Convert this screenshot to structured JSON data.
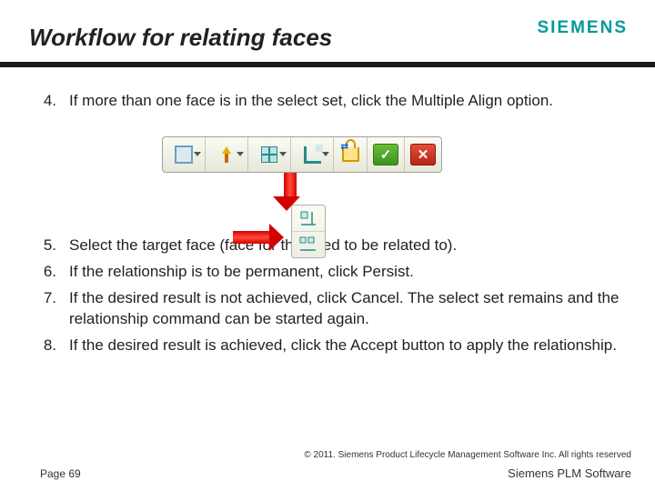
{
  "header": {
    "title": "Workflow for relating faces",
    "logo": "SIEMENS"
  },
  "steps": [
    {
      "n": "4.",
      "text": "If more than one face is in the select set, click the Multiple Align option."
    },
    {
      "n": "5.",
      "text": "Select the target face (face for the seed to be related to)."
    },
    {
      "n": "6.",
      "text": "If the relationship is to be permanent, click Persist."
    },
    {
      "n": "7.",
      "text": "If the desired result is not achieved, click Cancel. The select set remains and the relationship command can be started again."
    },
    {
      "n": "8.",
      "text": "If the desired result is achieved, click the Accept button to apply the relationship."
    }
  ],
  "toolbar": {
    "buttons": [
      "select-rectangle",
      "seed-face",
      "multiple-align",
      "align-type",
      "persist-lock"
    ],
    "accept": "✓",
    "cancel": "✕"
  },
  "dropdown": {
    "options": [
      "align-single",
      "align-multiple"
    ]
  },
  "footer": {
    "copyright": "© 2011. Siemens Product Lifecycle Management Software Inc. All rights reserved",
    "page": "Page 69",
    "product": "Siemens PLM Software"
  }
}
